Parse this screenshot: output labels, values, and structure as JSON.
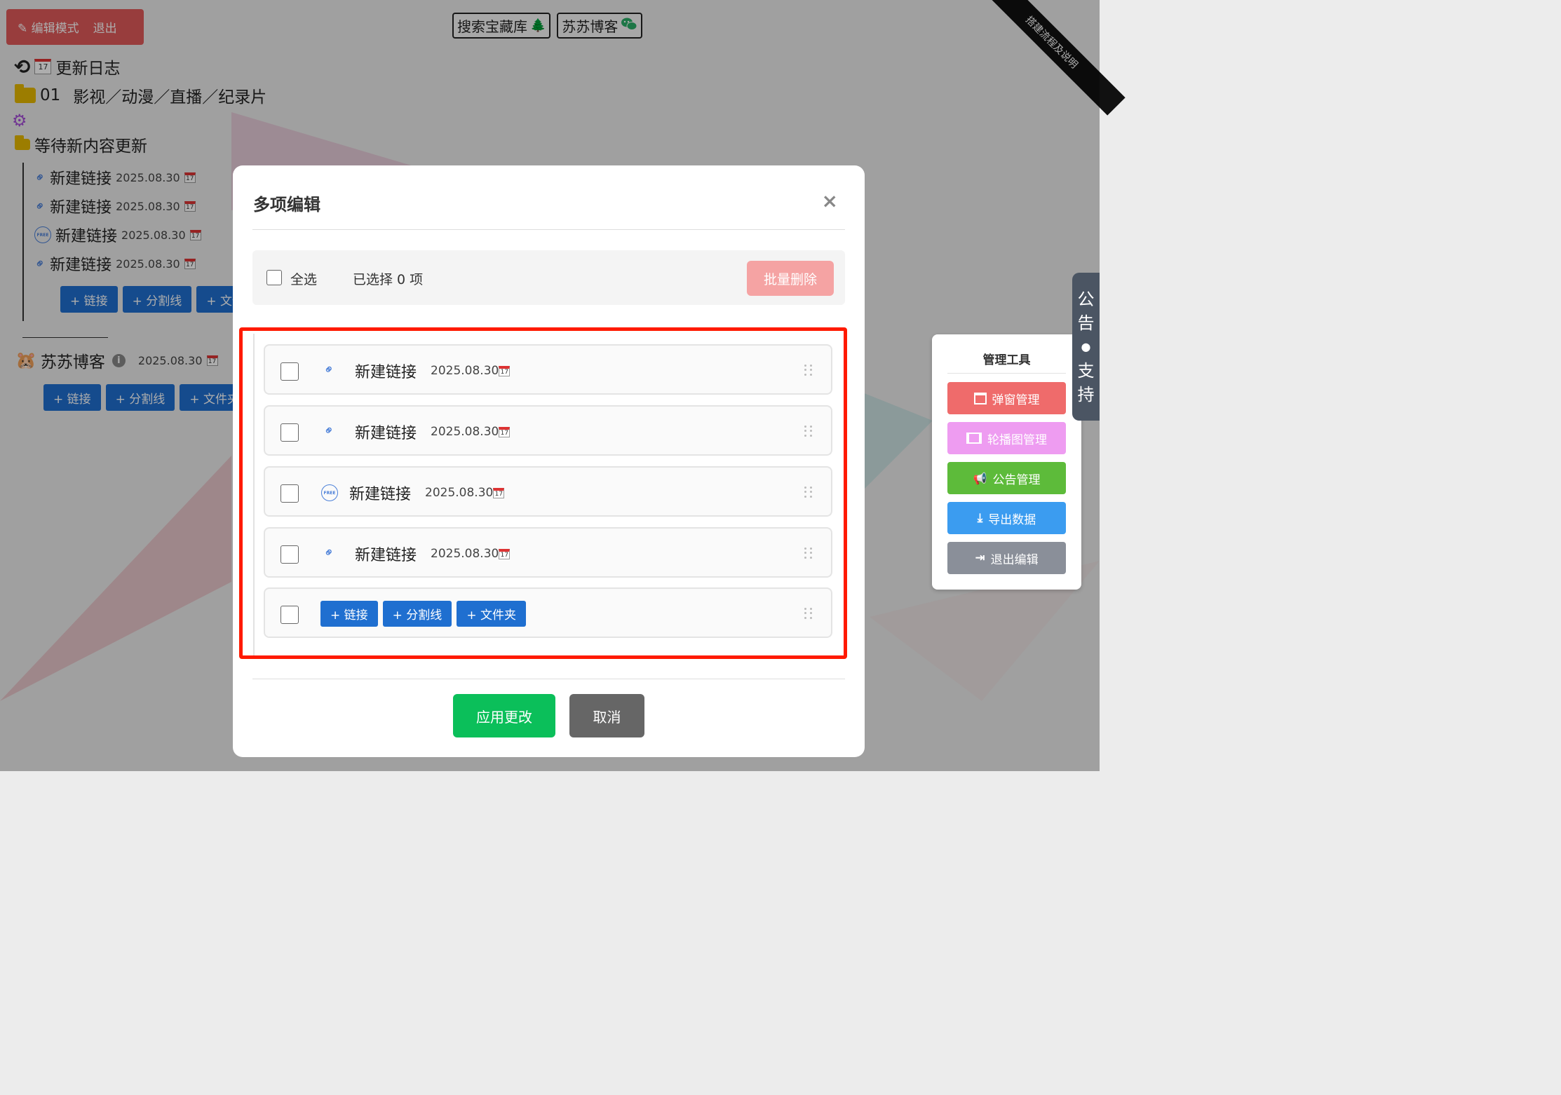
{
  "header": {
    "edit_mode": "编辑模式",
    "exit": "退出",
    "tags": [
      {
        "label": "搜索宝藏库",
        "icon": "🌲"
      },
      {
        "label": "苏苏博客",
        "icon": "wechat-icon"
      }
    ],
    "corner_ribbon": "搭建流程及说明"
  },
  "page": {
    "changelog": "更新日志",
    "category1_num": "01",
    "category1_title": "影视／动漫／直播／纪录片",
    "pending_folder": "等待新内容更新",
    "links": [
      {
        "title": "新建链接",
        "date": "2025.08.30",
        "icon": "link-icon"
      },
      {
        "title": "新建链接",
        "date": "2025.08.30",
        "icon": "link-icon"
      },
      {
        "title": "新建链接",
        "date": "2025.08.30",
        "icon": "free-icon"
      },
      {
        "title": "新建链接",
        "date": "2025.08.30",
        "icon": "link-icon"
      }
    ],
    "add_buttons": [
      "+ 链接",
      "+ 分割线",
      "+ 文件夹"
    ],
    "add_buttons_cut": "+ 文件",
    "blog_title": "苏苏博客",
    "blog_date": "2025.08.30",
    "blog_add_buttons": [
      "+ 链接",
      "+ 分割线",
      "+ 文件夹"
    ]
  },
  "modal": {
    "title": "多项编辑",
    "close": "×",
    "select_all": "全选",
    "selected_count": "已选择 0 项",
    "batch_delete": "批量删除",
    "items": [
      {
        "title": "新建链接",
        "date": "2025.08.30",
        "icon": "link-icon"
      },
      {
        "title": "新建链接",
        "date": "2025.08.30",
        "icon": "link-icon"
      },
      {
        "title": "新建链接",
        "date": "2025.08.30",
        "icon": "free-icon"
      },
      {
        "title": "新建链接",
        "date": "2025.08.30",
        "icon": "link-icon"
      }
    ],
    "add_row_buttons": [
      "+ 链接",
      "+ 分割线",
      "+ 文件夹"
    ],
    "apply": "应用更改",
    "cancel": "取消"
  },
  "admin_tools": {
    "title": "管理工具",
    "buttons": [
      {
        "label": "弹窗管理",
        "color": "#ef6b6b",
        "icon": "window-icon"
      },
      {
        "label": "轮播图管理",
        "color": "#ee9cf1",
        "icon": "film-icon"
      },
      {
        "label": "公告管理",
        "color": "#5dbb3a",
        "icon": "megaphone-icon"
      },
      {
        "label": "导出数据",
        "color": "#3b9cf0",
        "icon": "download-icon"
      },
      {
        "label": "退出编辑",
        "color": "#8a8f99",
        "icon": "sign-out-icon"
      }
    ]
  },
  "side_notice": {
    "chars": [
      "公",
      "告",
      "●",
      "支",
      "持"
    ]
  }
}
